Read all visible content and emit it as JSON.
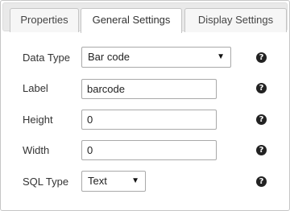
{
  "tabs": [
    {
      "label": "Properties",
      "active": false
    },
    {
      "label": "General Settings",
      "active": true
    },
    {
      "label": "Display Settings",
      "active": false
    }
  ],
  "form": {
    "data_type": {
      "label": "Data Type",
      "value": "Bar code"
    },
    "label_field": {
      "label": "Label",
      "value": "barcode"
    },
    "height": {
      "label": "Height",
      "value": "0"
    },
    "width": {
      "label": "Width",
      "value": "0"
    },
    "sql_type": {
      "label": "SQL Type",
      "value": "Text"
    }
  },
  "icons": {
    "help": "question-circle-icon",
    "help_glyph": "?",
    "caret_glyph": "▼"
  }
}
